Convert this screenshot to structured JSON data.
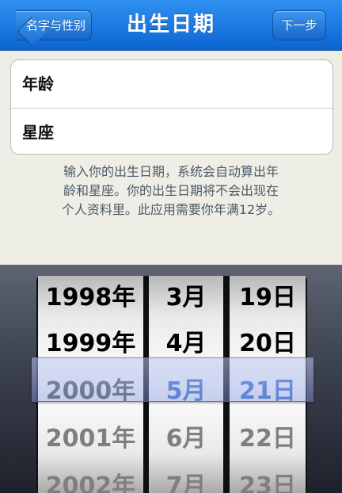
{
  "navbar": {
    "title": "出生日期",
    "back_label": "名字与性别",
    "next_label": "下一步"
  },
  "form": {
    "age_label": "年龄",
    "zodiac_label": "星座"
  },
  "note": {
    "line1": "输入你的出生日期，系统会自动算出年",
    "line2": "龄和星座。你的出生日期将不会出现在",
    "line3": "个人资料里。此应用需要你年满12岁。"
  },
  "picker": {
    "years": [
      "1998年",
      "1999年",
      "2000年",
      "2001年",
      "2002年"
    ],
    "months": [
      "3月",
      "4月",
      "5月",
      "6月",
      "7月"
    ],
    "days": [
      "19日",
      "20日",
      "21日",
      "22日",
      "23日"
    ],
    "selected": {
      "year": "2000年",
      "month": "5月",
      "day": "21日"
    }
  },
  "colors": {
    "nav_blue": "#1f7de6",
    "selected_text": "#3a6fd0"
  }
}
